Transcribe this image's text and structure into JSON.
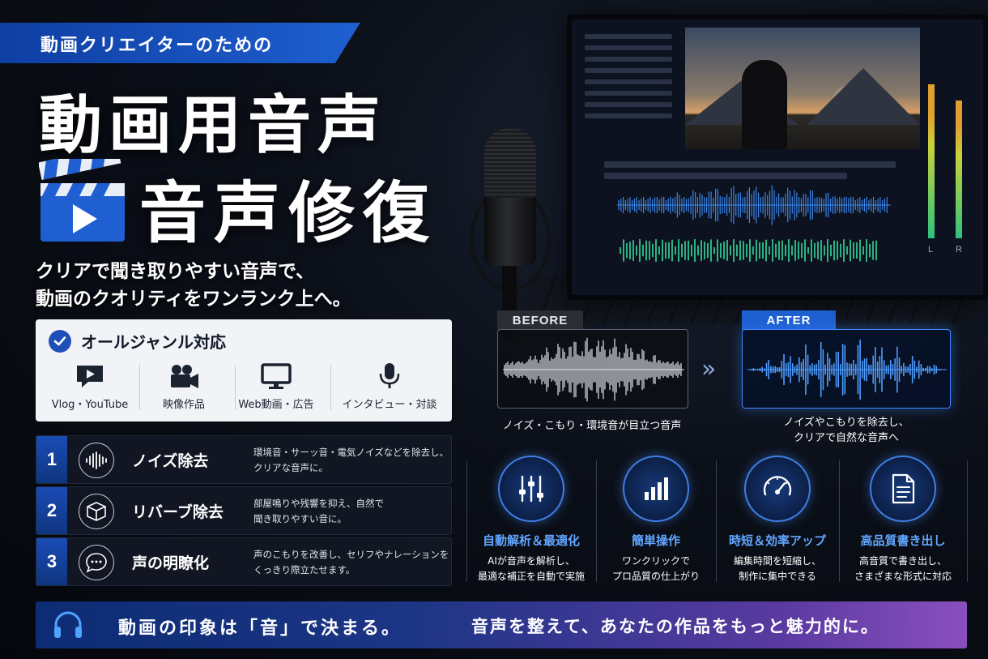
{
  "header": {
    "tag": "動画クリエイターのための",
    "title_line1": "動画用音声",
    "title_line2": "音声修復",
    "subtitle": [
      "クリアで聞き取りやすい音声で、",
      "動画のクオリティをワンランク上へ。"
    ]
  },
  "genres": {
    "title": "オールジャンル対応",
    "items": [
      {
        "label": "Vlog・YouTube",
        "icon": "speech-bubble-play-icon"
      },
      {
        "label": "映像作品",
        "icon": "video-camera-icon"
      },
      {
        "label": "Web動画・広告",
        "icon": "monitor-icon"
      },
      {
        "label": "インタビュー・対談",
        "icon": "microphone-icon"
      }
    ]
  },
  "features": [
    {
      "number": "1",
      "name": "ノイズ除去",
      "icon": "waveform-icon",
      "desc": [
        "環境音・サーッ音・電気ノイズなどを除去し、",
        "クリアな音声に。"
      ]
    },
    {
      "number": "2",
      "name": "リバーブ除去",
      "icon": "cube-icon",
      "desc": [
        "部屋鳴りや残響を抑え、自然で",
        "聞き取りやすい音に。"
      ]
    },
    {
      "number": "3",
      "name": "声の明瞭化",
      "icon": "chat-bubble-icon",
      "desc": [
        "声のこもりを改善し、セリフやナレーションを",
        "くっきり際立たせます。"
      ]
    }
  ],
  "comparison": {
    "before_label": "BEFORE",
    "after_label": "AFTER",
    "before_caption": [
      "ノイズ・こもり・環境音が目立つ音声"
    ],
    "after_caption": [
      "ノイズやこもりを除去し、",
      "クリアで自然な音声へ"
    ]
  },
  "benefits": [
    {
      "title": "自動解析＆最適化",
      "icon": "sliders-icon",
      "desc": [
        "AIが音声を解析し、",
        "最適な補正を自動で実施"
      ]
    },
    {
      "title": "簡単操作",
      "icon": "bar-chart-icon",
      "desc": [
        "ワンクリックで",
        "プロ品質の仕上がり"
      ]
    },
    {
      "title": "時短＆効率アップ",
      "icon": "speedometer-icon",
      "desc": [
        "編集時間を短縮し、",
        "制作に集中できる"
      ]
    },
    {
      "title": "高品質書き出し",
      "icon": "document-icon",
      "desc": [
        "高音質で書き出し、",
        "さまざまな形式に対応"
      ]
    }
  ],
  "banner": {
    "left": "動画の印象は「音」で決まる。",
    "right": "音声を整えて、あなたの作品をもっと魅力的に。",
    "icon": "headphones-icon"
  },
  "monitor": {
    "meter_labels": [
      "L",
      "R"
    ]
  },
  "colors": {
    "accent_blue": "#1e5fd0",
    "highlight_blue": "#62a6ff",
    "banner_purple": "#8a4fbf"
  }
}
